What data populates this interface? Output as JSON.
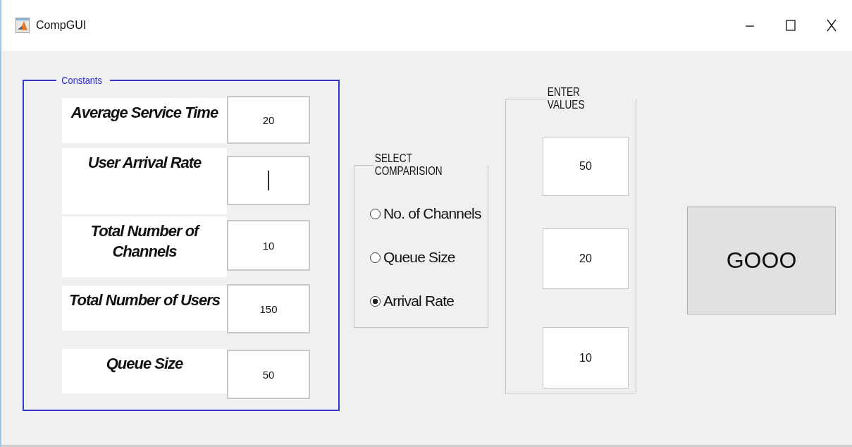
{
  "window": {
    "title": "CompGUI"
  },
  "constants": {
    "title": "Constants",
    "fields": [
      {
        "label": "Average Service Time",
        "value": "20",
        "focused": false
      },
      {
        "label": "User Arrival Rate",
        "focused": true
      },
      {
        "label": "Total Number of Channels",
        "value": "10",
        "focused": false
      },
      {
        "label": "Total Number of Users",
        "value": "150",
        "focused": false
      },
      {
        "label": "Queue Size",
        "value": "50",
        "focused": false
      }
    ]
  },
  "comparison": {
    "title": "SELECT COMPARISION",
    "options": [
      {
        "label": "No. of Channels",
        "selected": false
      },
      {
        "label": "Queue Size",
        "selected": false
      },
      {
        "label": "Arrival Rate",
        "selected": true
      }
    ]
  },
  "enter_values": {
    "title": "ENTER VALUES",
    "values": [
      "50",
      "20",
      "10"
    ]
  },
  "button": {
    "label": "GOOO"
  }
}
